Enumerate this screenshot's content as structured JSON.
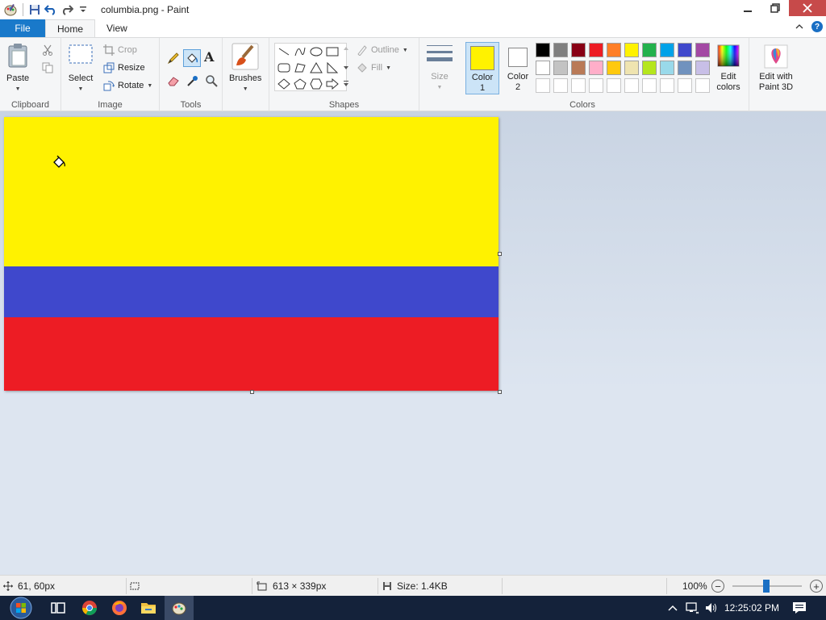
{
  "window": {
    "title": "columbia.png - Paint"
  },
  "tabs": {
    "file": "File",
    "home": "Home",
    "view": "View"
  },
  "ribbon": {
    "clipboard": {
      "paste": "Paste",
      "group": "Clipboard"
    },
    "image": {
      "select": "Select",
      "crop": "Crop",
      "resize": "Resize",
      "rotate": "Rotate",
      "group": "Image"
    },
    "tools": {
      "group": "Tools"
    },
    "brushes": {
      "label": "Brushes"
    },
    "shapes": {
      "outline": "Outline",
      "fill": "Fill",
      "group": "Shapes"
    },
    "size": {
      "label": "Size"
    },
    "colors": {
      "color1_a": "Color",
      "color1_b": "1",
      "color2_a": "Color",
      "color2_b": "2",
      "edit_a": "Edit",
      "edit_b": "colors",
      "paint3d_a": "Edit with",
      "paint3d_b": "Paint 3D",
      "group": "Colors",
      "color1_value": "#fff200",
      "color2_value": "#ffffff",
      "palette_row1": [
        "#000000",
        "#7f7f7f",
        "#880015",
        "#ed1c24",
        "#ff7f27",
        "#fff200",
        "#22b14c",
        "#00a2e8",
        "#3f48cc",
        "#a349a4"
      ],
      "palette_row2": [
        "#ffffff",
        "#c3c3c3",
        "#b97a57",
        "#ffaec9",
        "#ffc90e",
        "#efe4b0",
        "#b5e61d",
        "#99d9ea",
        "#7092be",
        "#c8bfe7"
      ],
      "palette_row3": [
        "#ffffff",
        "#ffffff",
        "#ffffff",
        "#ffffff",
        "#ffffff",
        "#ffffff",
        "#ffffff",
        "#ffffff",
        "#ffffff",
        "#ffffff"
      ]
    }
  },
  "canvas": {
    "stripes": [
      "#fff200",
      "#3f48cc",
      "#ed1c24"
    ]
  },
  "status": {
    "cursor_pos": "61, 60px",
    "image_size": "613 × 339px",
    "file_size": "Size: 1.4KB",
    "zoom": "100%"
  },
  "taskbar": {
    "time": "12:25:02 PM"
  }
}
